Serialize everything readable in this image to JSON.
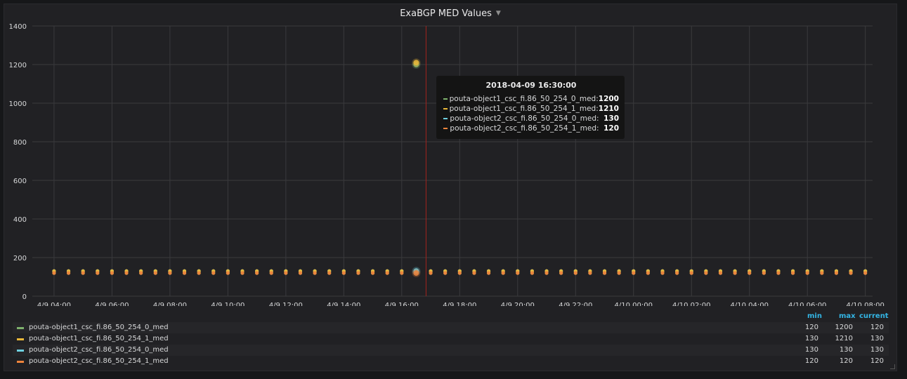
{
  "panel": {
    "title": "ExaBGP MED Values"
  },
  "colors": {
    "series0": "#7eb26d",
    "series1": "#eab839",
    "series2": "#6ed0e0",
    "series3": "#ef843c",
    "grid": "#3a3a3d",
    "crosshair": "#a2231c",
    "axis_text": "#d8d9da"
  },
  "chart_data": {
    "type": "scatter",
    "title": "ExaBGP MED Values",
    "ylim": [
      0,
      1400
    ],
    "yticks": [
      0,
      200,
      400,
      600,
      800,
      1000,
      1200,
      1400
    ],
    "xlim": [
      "2018-04-09 03:15",
      "2018-04-10 08:15"
    ],
    "xtick_labels": [
      "4/9 04:00",
      "4/9 06:00",
      "4/9 08:00",
      "4/9 10:00",
      "4/9 12:00",
      "4/9 14:00",
      "4/9 16:00",
      "4/9 18:00",
      "4/9 20:00",
      "4/9 22:00",
      "4/10 00:00",
      "4/10 02:00",
      "4/10 04:00",
      "4/10 06:00",
      "4/10 08:00"
    ],
    "grid": true,
    "interval_minutes": 30,
    "x_start": "2018-04-09 04:00",
    "x_end": "2018-04-10 08:00",
    "spike_time": "2018-04-09 16:30",
    "series": [
      {
        "name": "pouta-object1_csc_fi.86_50_254_0_med",
        "baseline": 120,
        "spike": 1200,
        "min": "120",
        "max": "1200",
        "current": "120"
      },
      {
        "name": "pouta-object1_csc_fi.86_50_254_1_med",
        "baseline": 130,
        "spike": 1210,
        "min": "130",
        "max": "1210",
        "current": "130"
      },
      {
        "name": "pouta-object2_csc_fi.86_50_254_0_med",
        "baseline": 130,
        "spike": 130,
        "min": "130",
        "max": "130",
        "current": "130"
      },
      {
        "name": "pouta-object2_csc_fi.86_50_254_1_med",
        "baseline": 120,
        "spike": 120,
        "min": "120",
        "max": "120",
        "current": "120"
      }
    ],
    "legend_headers": {
      "min": "min",
      "max": "max",
      "current": "current"
    }
  },
  "tooltip": {
    "time": "2018-04-09 16:30:00",
    "rows": [
      {
        "label": "pouta-object1_csc_fi.86_50_254_0_med:",
        "value": "1200"
      },
      {
        "label": "pouta-object1_csc_fi.86_50_254_1_med:",
        "value": "1210"
      },
      {
        "label": "pouta-object2_csc_fi.86_50_254_0_med:",
        "value": "130"
      },
      {
        "label": "pouta-object2_csc_fi.86_50_254_1_med:",
        "value": "120"
      }
    ]
  }
}
